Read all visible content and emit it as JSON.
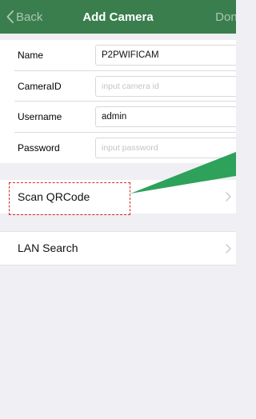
{
  "nav": {
    "back_label": "Back",
    "title": "Add Camera",
    "done_label": "Done"
  },
  "form": {
    "rows": [
      {
        "label": "Name",
        "value": "P2PWIFICAM",
        "placeholder": ""
      },
      {
        "label": "CameraID",
        "value": "",
        "placeholder": "input camera id"
      },
      {
        "label": "Username",
        "value": "admin",
        "placeholder": ""
      },
      {
        "label": "Password",
        "value": "",
        "placeholder": "input password"
      }
    ]
  },
  "actions": {
    "scan_label": "Scan QRCode",
    "lan_label": "LAN Search"
  },
  "colors": {
    "nav_bg": "#3a7e4e",
    "highlight_border": "#d42a2a",
    "callout": "#2ea15a"
  },
  "icons": {
    "back": "chevron-left-icon",
    "row_chevron": "chevron-right-icon"
  }
}
